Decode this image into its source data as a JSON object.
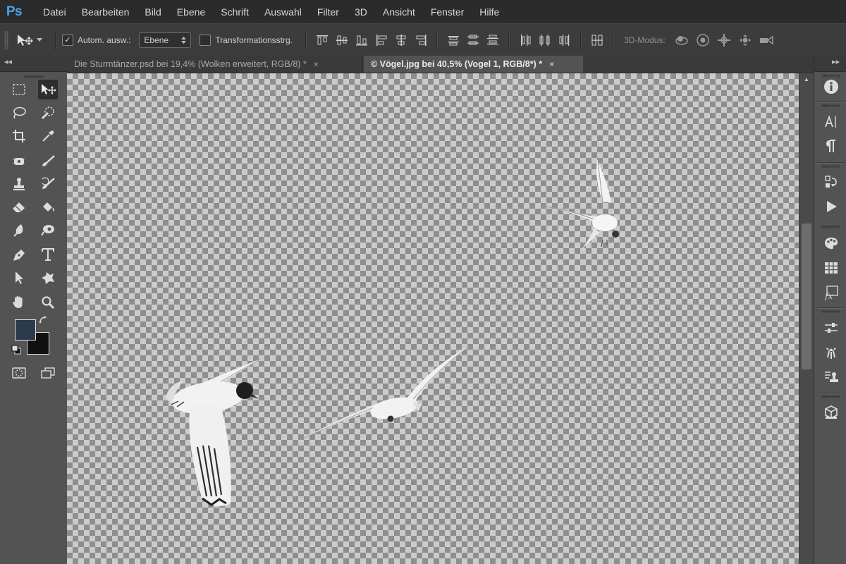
{
  "app": {
    "logo": "Ps",
    "menu": [
      "Datei",
      "Bearbeiten",
      "Bild",
      "Ebene",
      "Schrift",
      "Auswahl",
      "Filter",
      "3D",
      "Ansicht",
      "Fenster",
      "Hilfe"
    ]
  },
  "options": {
    "auto_select_label": "Autom. ausw.:",
    "auto_select_checked": true,
    "auto_select_target": "Ebene",
    "transform_label": "Transformationsstrg.",
    "transform_checked": false,
    "mode3d_label": "3D-Modus:"
  },
  "tabs": [
    {
      "title": "Die Sturmtänzer.psd bei 19,4% (Wolken erweitert, RGB/8) *",
      "close": "×",
      "active": false
    },
    {
      "title": "© Vögel.jpg bei 40,5% (Vogel 1, RGB/8*) *",
      "close": "×",
      "active": true
    }
  ],
  "toolbar": {
    "collapse": "◂◂",
    "foreground_color": "#2c3a4d",
    "background_color": "#111111",
    "active_tool": "move-tool"
  },
  "right_panel": {
    "collapse": "▸▸"
  },
  "scrollbar": {
    "up_arrow": "▲"
  }
}
